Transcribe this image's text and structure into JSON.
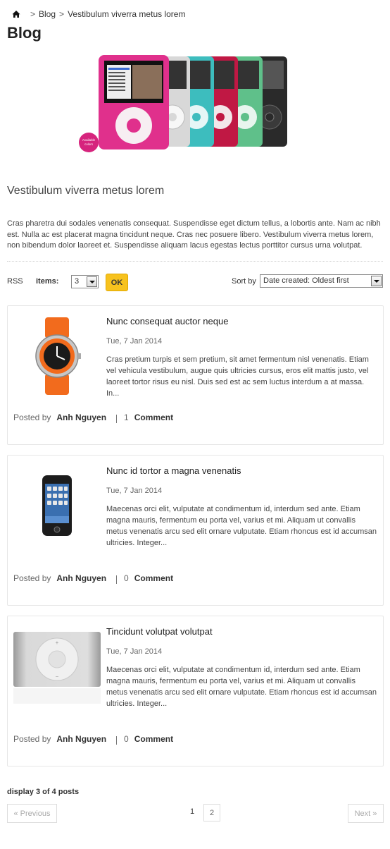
{
  "breadcrumb": {
    "home_icon": "home-icon",
    "separator": ">",
    "items": [
      "Blog",
      "Vestibulum viverra metus lorem"
    ]
  },
  "page_title": "Blog",
  "hero": {
    "badge_text": "Available colors"
  },
  "blog": {
    "subtitle": "Vestibulum viverra metus lorem",
    "description": "Cras pharetra dui sodales venenatis consequat. Suspendisse eget dictum tellus, a lobortis ante. Nam ac nibh est. Nulla ac est placerat magna tincidunt neque. Cras nec posuere libero. Vestibulum viverra metus lorem, non bibendum dolor laoreet et. Suspendisse aliquam lacus egestas lectus porttitor cursus urna volutpat."
  },
  "toolbar": {
    "rss_label": "RSS",
    "items_label": "items:",
    "items_value": "3",
    "ok_label": "OK",
    "sort_label": "Sort by",
    "sort_value": "Date created: Oldest first"
  },
  "posts": [
    {
      "title": "Nunc consequat auctor neque",
      "date": "Tue, 7 Jan 2014",
      "excerpt": "Cras pretium turpis et sem pretium, sit amet fermentum nisl venenatis. Etiam vel vehicula vestibulum, augue quis ultricies cursus, eros elit mattis justo, vel laoreet tortor risus eu nisl. Duis sed est ac sem luctus interdum a at massa. In...",
      "posted_by_label": "Posted by",
      "author": "Anh Nguyen",
      "comment_count": "1",
      "comment_label": "Comment",
      "thumb_icon": "watch-image"
    },
    {
      "title": "Nunc id tortor a magna venenatis",
      "date": "Tue, 7 Jan 2014",
      "excerpt": "Maecenas orci elit, vulputate at condimentum id, interdum sed ante. Etiam magna mauris, fermentum eu porta vel, varius et mi. Aliquam ut convallis metus venenatis arcu sed elit ornare vulputate. Etiam rhoncus est id accumsan ultricies. Integer...",
      "posted_by_label": "Posted by",
      "author": "Anh Nguyen",
      "comment_count": "0",
      "comment_label": "Comment",
      "thumb_icon": "iphone-image"
    },
    {
      "title": "Tincidunt volutpat volutpat",
      "date": "Tue, 7 Jan 2014",
      "excerpt": "Maecenas orci elit, vulputate at condimentum id, interdum sed ante. Etiam magna mauris, fermentum eu porta vel, varius et mi. Aliquam ut convallis metus venenatis arcu sed elit ornare vulputate. Etiam rhoncus est id accumsan ultricies. Integer...",
      "posted_by_label": "Posted by",
      "author": "Anh Nguyen",
      "comment_count": "0",
      "comment_label": "Comment",
      "thumb_icon": "ipod-shuffle-image"
    }
  ],
  "display_count": "display 3 of 4 posts",
  "pagination": {
    "previous_label": "« Previous",
    "pages": [
      "1",
      "2"
    ],
    "current_page": "1",
    "next_label": "Next »"
  },
  "colors": {
    "accent": "#f7c21e",
    "border": "#e6e6e6"
  }
}
